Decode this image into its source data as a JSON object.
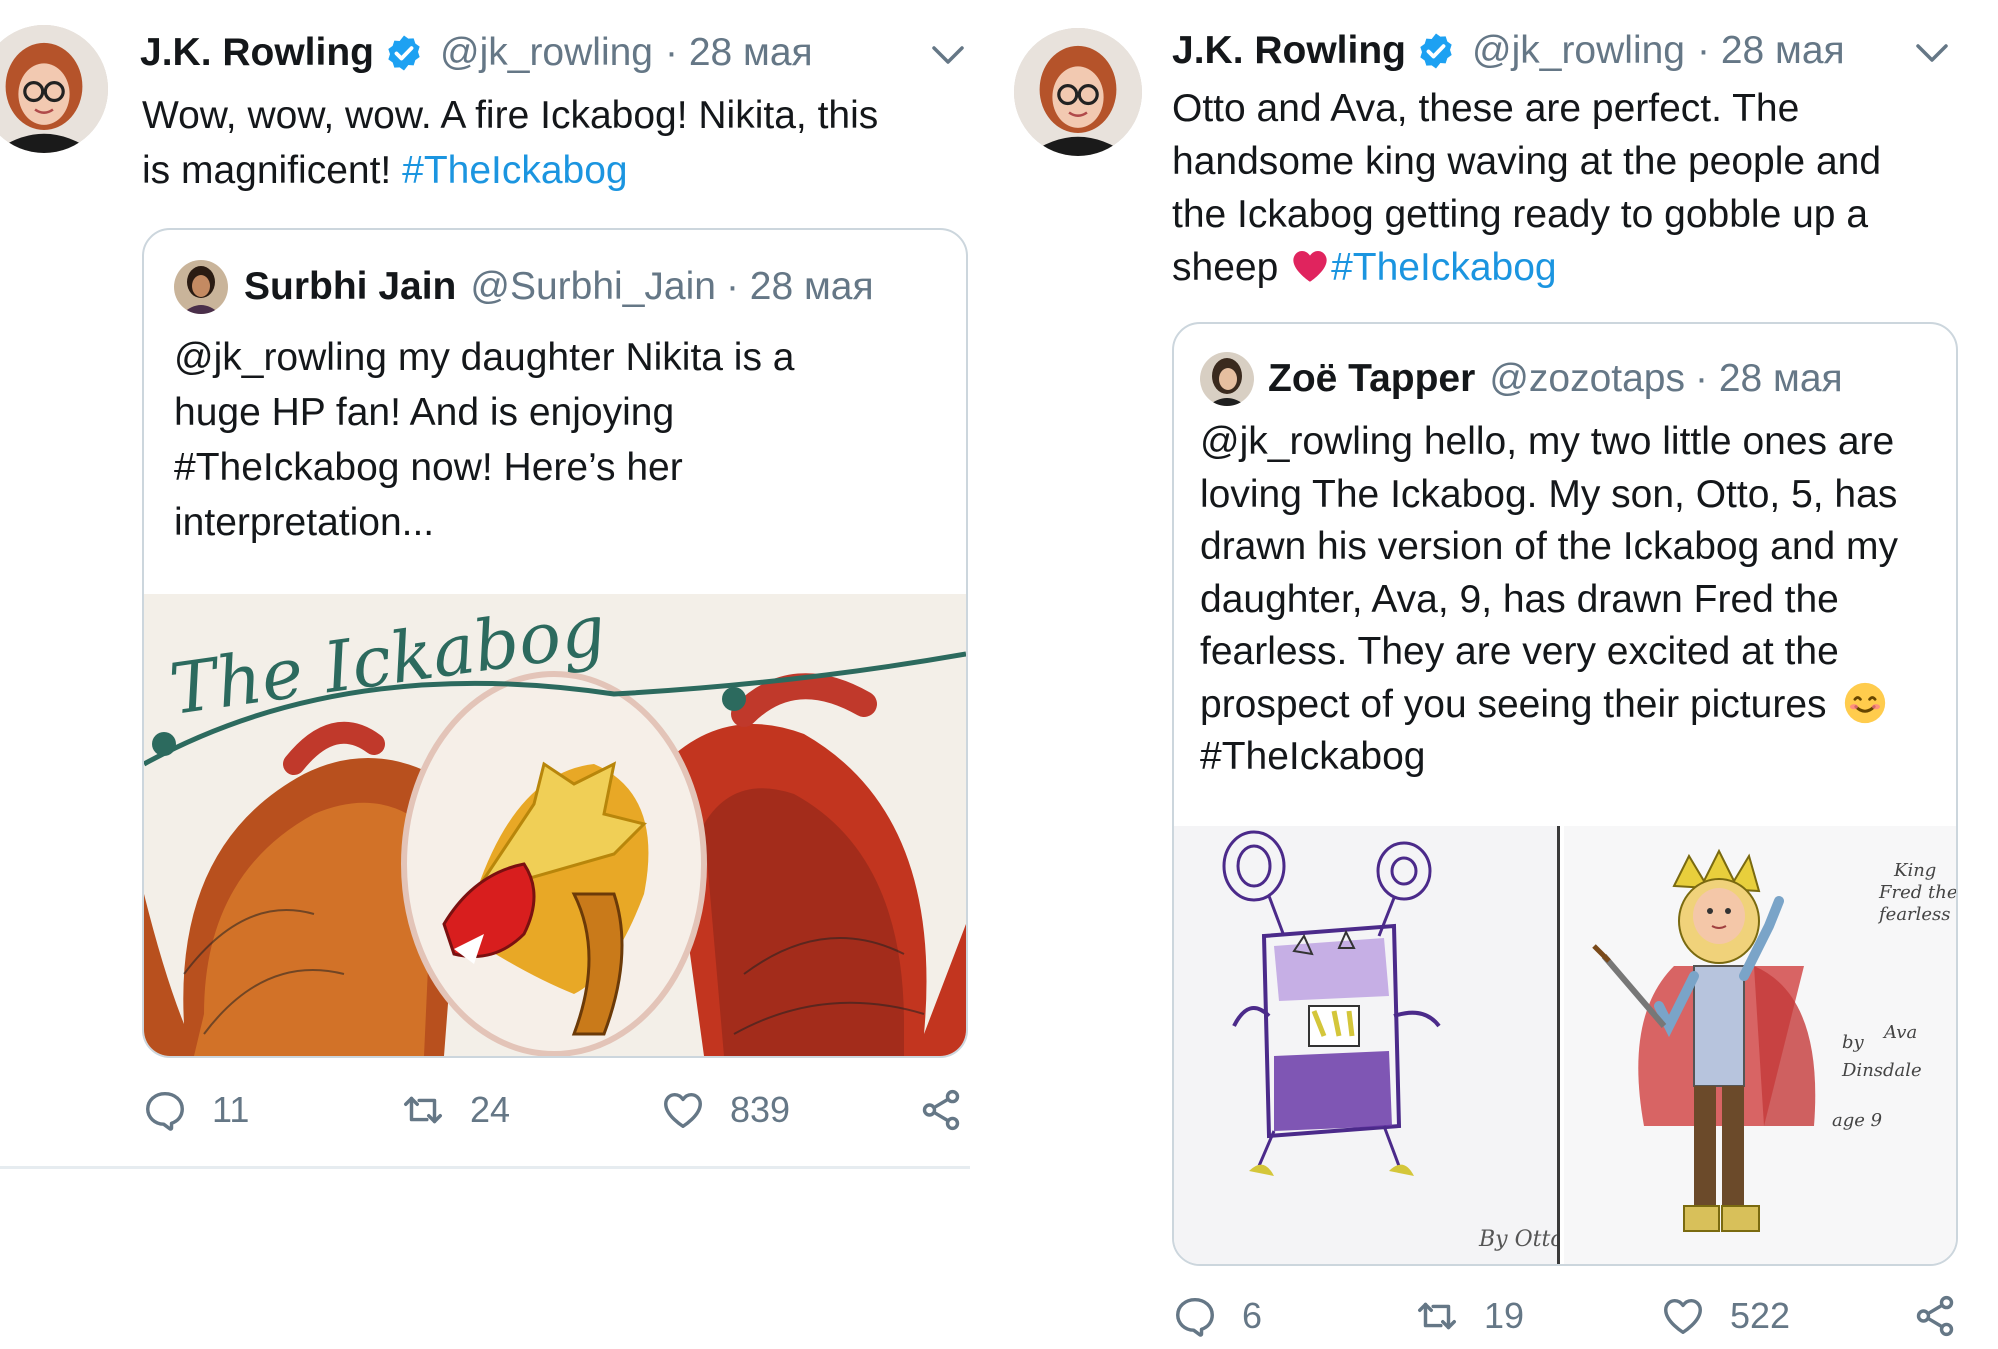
{
  "left_tweet": {
    "author": "J.K. Rowling",
    "handle": "@jk_rowling",
    "date": "· 28 мая",
    "text_line1": "Wow, wow, wow. A fire Ickabog! Nikita, this",
    "text_line2": "is magnificent!",
    "hashtag": "#TheIckabog",
    "quote": {
      "author": "Surbhi Jain",
      "handle": "@Surbhi_Jain",
      "date": "· 28 мая",
      "lines": [
        "@jk_rowling my daughter Nikita is a",
        "huge HP fan! And is enjoying",
        "#TheIckabog now! Here’s her",
        "interpretation..."
      ],
      "drawing_title": "The Ickabog"
    },
    "replies": "11",
    "retweets": "24",
    "likes": "839"
  },
  "right_tweet": {
    "author": "J.K. Rowling",
    "handle": "@jk_rowling",
    "date": "· 28 мая",
    "lines": [
      "Otto and Ava, these are perfect. The",
      "handsome king waving at the people and",
      "the Ickabog getting ready to gobble up a"
    ],
    "line4_start": "sheep",
    "hashtag": "#TheIckabog",
    "quote": {
      "author": "Zoë Tapper",
      "handle": "@zozotaps",
      "date": "· 28 мая",
      "lines": [
        "@jk_rowling hello, my two little ones are",
        "loving The Ickabog. My son, Otto, 5, has",
        "drawn his version of the Ickabog and my",
        "daughter, Ava, 9, has drawn Fred the",
        "fearless. They are very excited at the",
        "prospect of you seeing their pictures",
        "#TheIckabog"
      ],
      "drawing1_signature": "By Otto",
      "drawing2_caption": [
        "King",
        "Fred the",
        "fearless"
      ],
      "drawing2_byline": [
        "by",
        "Ava",
        "Dinsdale",
        "age 9"
      ]
    },
    "replies": "6",
    "retweets": "19",
    "likes": "522"
  },
  "colors": {
    "text": "#14171a",
    "muted": "#657786",
    "link": "#1b95e0",
    "border": "#ccd6dd",
    "verified": "#1da1f2",
    "heart_emoji": "#e0245e"
  },
  "icons": [
    "reply-icon",
    "retweet-icon",
    "like-icon",
    "share-icon",
    "verified-badge-icon",
    "chevron-down-icon",
    "red-heart-emoji",
    "smiling-face-emoji"
  ]
}
